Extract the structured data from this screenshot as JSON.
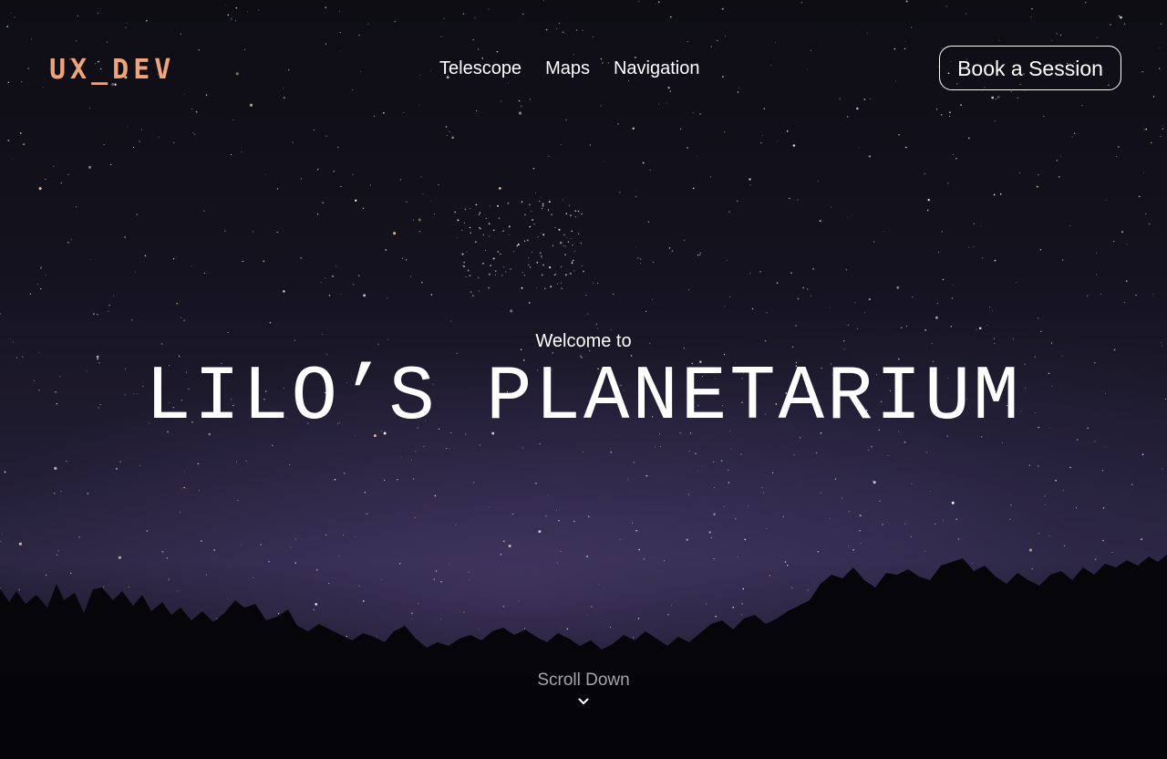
{
  "header": {
    "logo": "UX_DEV",
    "nav": [
      {
        "label": "Telescope"
      },
      {
        "label": "Maps"
      },
      {
        "label": "Navigation"
      }
    ],
    "cta_label": "Book a Session"
  },
  "hero": {
    "kicker": "Welcome to",
    "title": "LILO’S PLANETARIUM"
  },
  "scroll": {
    "label": "Scroll Down",
    "icon": "chevron-down-icon"
  },
  "colors": {
    "logo": "#f0a47a",
    "text": "#ffffff",
    "muted": "#a4a4ac"
  }
}
